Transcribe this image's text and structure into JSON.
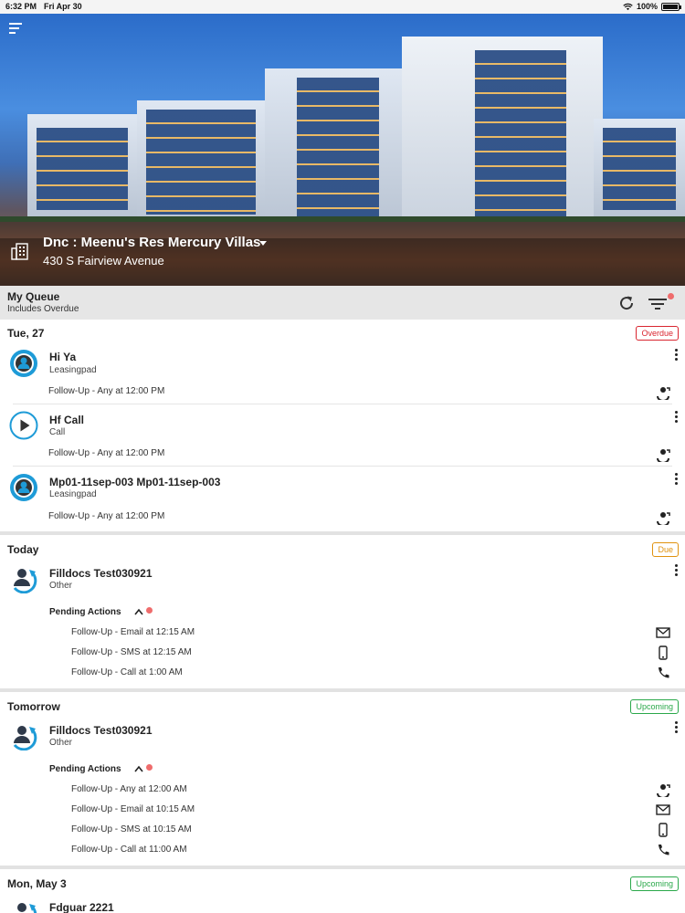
{
  "status_bar": {
    "time": "6:32 PM",
    "date": "Fri Apr 30",
    "battery": "100%"
  },
  "header": {
    "property_name": "Dnc : Meenu's Res Mercury Villas",
    "property_address": "430 S Fairview Avenue"
  },
  "queue": {
    "title": "My Queue",
    "subtitle": "Includes Overdue"
  },
  "sections": [
    {
      "label": "Tue, 27",
      "badge": "Overdue",
      "items": [
        {
          "name": "Hi Ya",
          "source": "Leasingpad",
          "follow_up": "Follow-Up - Any at 12:00 PM"
        },
        {
          "name": "Hf Call",
          "source": "Call",
          "follow_up": "Follow-Up - Any at 12:00 PM"
        },
        {
          "name": "Mp01-11sep-003 Mp01-11sep-003",
          "source": "Leasingpad",
          "follow_up": "Follow-Up - Any at 12:00 PM"
        }
      ]
    },
    {
      "label": "Today",
      "badge": "Due",
      "items": [
        {
          "name": "Filldocs Test030921",
          "source": "Other",
          "pending_label": "Pending Actions",
          "pending": [
            "Follow-Up - Email at 12:15 AM",
            "Follow-Up - SMS at 12:15 AM",
            "Follow-Up - Call at 1:00 AM"
          ]
        }
      ]
    },
    {
      "label": "Tomorrow",
      "badge": "Upcoming",
      "items": [
        {
          "name": "Filldocs Test030921",
          "source": "Other",
          "pending_label": "Pending Actions",
          "pending": [
            "Follow-Up - Any at 12:00 AM",
            "Follow-Up - Email at 10:15 AM",
            "Follow-Up - SMS at 10:15 AM",
            "Follow-Up - Call at 11:00 AM"
          ]
        }
      ]
    },
    {
      "label": "Mon, May 3",
      "badge": "Upcoming",
      "items": [
        {
          "name": "Fdguar 2221"
        }
      ]
    }
  ],
  "colors": {
    "accent_blue": "#1e9bd7",
    "overdue": "#d9252f",
    "due": "#e0920f",
    "upcoming": "#2aa84a",
    "queue_bar": "#e6e6e6"
  },
  "icons": {
    "menu": "menu-icon",
    "property": "building-icon",
    "refresh": "refresh-icon",
    "filter": "filter-icon",
    "any_action": "person-action-icon",
    "email": "email-icon",
    "sms": "phone-icon",
    "call": "call-icon"
  }
}
